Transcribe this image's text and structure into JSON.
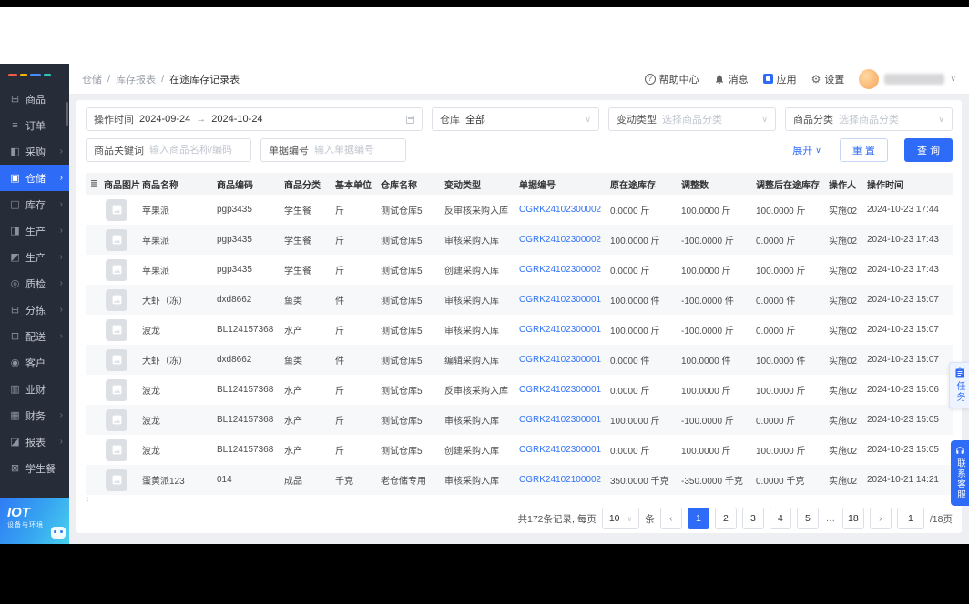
{
  "sidebar": {
    "items": [
      {
        "label": "商品",
        "icon": "grid",
        "chevron": false,
        "active": false
      },
      {
        "label": "订单",
        "icon": "order",
        "chevron": false,
        "active": false
      },
      {
        "label": "采购",
        "icon": "cart",
        "chevron": true,
        "active": false
      },
      {
        "label": "仓储",
        "icon": "warehouse",
        "chevron": true,
        "active": true
      },
      {
        "label": "库存",
        "icon": "inventory",
        "chevron": true,
        "active": false
      },
      {
        "label": "生产",
        "icon": "production",
        "chevron": true,
        "active": false
      },
      {
        "label": "生产",
        "icon": "production2",
        "chevron": true,
        "active": false
      },
      {
        "label": "质检",
        "icon": "qc",
        "chevron": true,
        "active": false
      },
      {
        "label": "分拣",
        "icon": "sorting",
        "chevron": true,
        "active": false
      },
      {
        "label": "配送",
        "icon": "delivery",
        "chevron": true,
        "active": false
      },
      {
        "label": "客户",
        "icon": "customer",
        "chevron": false,
        "active": false
      },
      {
        "label": "业财",
        "icon": "biz_finance",
        "chevron": false,
        "active": false
      },
      {
        "label": "财务",
        "icon": "finance",
        "chevron": true,
        "active": false
      },
      {
        "label": "报表",
        "icon": "report",
        "chevron": true,
        "active": false
      },
      {
        "label": "学生餐",
        "icon": "student_meal",
        "chevron": false,
        "active": false
      }
    ],
    "iot": {
      "title": "IOT",
      "subtitle": "设备与环境"
    }
  },
  "header": {
    "breadcrumb": [
      "仓储",
      "库存报表",
      "在途库存记录表"
    ],
    "breadcrumb_sep": "/",
    "actions": {
      "help": "帮助中心",
      "messages": "消息",
      "apps": "应用",
      "settings": "设置"
    }
  },
  "filters": {
    "date": {
      "label": "操作时间",
      "start": "2024-09-24",
      "arrow": "→",
      "end": "2024-10-24"
    },
    "warehouse": {
      "label": "仓库",
      "value": "全部"
    },
    "change_type": {
      "label": "变动类型",
      "placeholder": "选择商品分类"
    },
    "category": {
      "label": "商品分类",
      "placeholder": "选择商品分类"
    },
    "keyword": {
      "label": "商品关键词",
      "placeholder": "输入商品名称/编码"
    },
    "doc_no": {
      "label": "单据编号",
      "placeholder": "输入单据编号"
    },
    "expand": "展开",
    "reset": "重 置",
    "query": "查 询"
  },
  "table": {
    "columns": [
      "商品图片",
      "商品名称",
      "商品编码",
      "商品分类",
      "基本单位",
      "仓库名称",
      "变动类型",
      "单据编号",
      "原在途库存",
      "调整数",
      "调整后在途库存",
      "操作人",
      "操作时间"
    ],
    "rows": [
      [
        "苹果派",
        "pgp3435",
        "学生餐",
        "斤",
        "测试仓库5",
        "反审核采购入库",
        "CGRK24102300002",
        "0.0000 斤",
        "100.0000 斤",
        "100.0000 斤",
        "实施02",
        "2024-10-23 17:44"
      ],
      [
        "苹果派",
        "pgp3435",
        "学生餐",
        "斤",
        "测试仓库5",
        "审核采购入库",
        "CGRK24102300002",
        "100.0000 斤",
        "-100.0000 斤",
        "0.0000 斤",
        "实施02",
        "2024-10-23 17:43"
      ],
      [
        "苹果派",
        "pgp3435",
        "学生餐",
        "斤",
        "测试仓库5",
        "创建采购入库",
        "CGRK24102300002",
        "0.0000 斤",
        "100.0000 斤",
        "100.0000 斤",
        "实施02",
        "2024-10-23 17:43"
      ],
      [
        "大虾（冻）",
        "dxd8662",
        "鱼类",
        "件",
        "测试仓库5",
        "审核采购入库",
        "CGRK24102300001",
        "100.0000 件",
        "-100.0000 件",
        "0.0000 件",
        "实施02",
        "2024-10-23 15:07"
      ],
      [
        "波龙",
        "BL124157368",
        "水产",
        "斤",
        "测试仓库5",
        "审核采购入库",
        "CGRK24102300001",
        "100.0000 斤",
        "-100.0000 斤",
        "0.0000 斤",
        "实施02",
        "2024-10-23 15:07"
      ],
      [
        "大虾（冻）",
        "dxd8662",
        "鱼类",
        "件",
        "测试仓库5",
        "编辑采购入库",
        "CGRK24102300001",
        "0.0000 件",
        "100.0000 件",
        "100.0000 件",
        "实施02",
        "2024-10-23 15:07"
      ],
      [
        "波龙",
        "BL124157368",
        "水产",
        "斤",
        "测试仓库5",
        "反审核采购入库",
        "CGRK24102300001",
        "0.0000 斤",
        "100.0000 斤",
        "100.0000 斤",
        "实施02",
        "2024-10-23 15:06"
      ],
      [
        "波龙",
        "BL124157368",
        "水产",
        "斤",
        "测试仓库5",
        "审核采购入库",
        "CGRK24102300001",
        "100.0000 斤",
        "-100.0000 斤",
        "0.0000 斤",
        "实施02",
        "2024-10-23 15:05"
      ],
      [
        "波龙",
        "BL124157368",
        "水产",
        "斤",
        "测试仓库5",
        "创建采购入库",
        "CGRK24102300001",
        "0.0000 斤",
        "100.0000 斤",
        "100.0000 斤",
        "实施02",
        "2024-10-23 15:05"
      ],
      [
        "蛋黄派123",
        "014",
        "成品",
        "千克",
        "老仓储专用",
        "审核采购入库",
        "CGRK24102100002",
        "350.0000 千克",
        "-350.0000 千克",
        "0.0000 千克",
        "实施02",
        "2024-10-21 14:21"
      ]
    ]
  },
  "pagination": {
    "total_text": "共172条记录, 每页",
    "page_size": "10",
    "unit": "条",
    "pages": [
      "1",
      "2",
      "3",
      "4",
      "5",
      "…",
      "18"
    ],
    "active_page": "1",
    "jump_value": "1",
    "jump_suffix": "/18页"
  },
  "floating": {
    "task": "任务",
    "service": "联系客服"
  },
  "icons": {
    "grid": "⊞",
    "order": "≡",
    "cart": "◧",
    "warehouse": "▣",
    "inventory": "◫",
    "production": "◨",
    "production2": "◩",
    "qc": "◎",
    "sorting": "⊟",
    "delivery": "⊡",
    "customer": "◉",
    "biz_finance": "▥",
    "finance": "▦",
    "report": "◪",
    "student_meal": "⊠",
    "chevron_down": "∨",
    "chevron_right": "›",
    "prev": "‹",
    "next": "›",
    "ellipsis": "…",
    "columns": "≣",
    "gear": "⚙"
  },
  "colors": {
    "primary": "#2e6bf6",
    "sidebar_bg": "#272c39",
    "link": "#3273f5"
  }
}
